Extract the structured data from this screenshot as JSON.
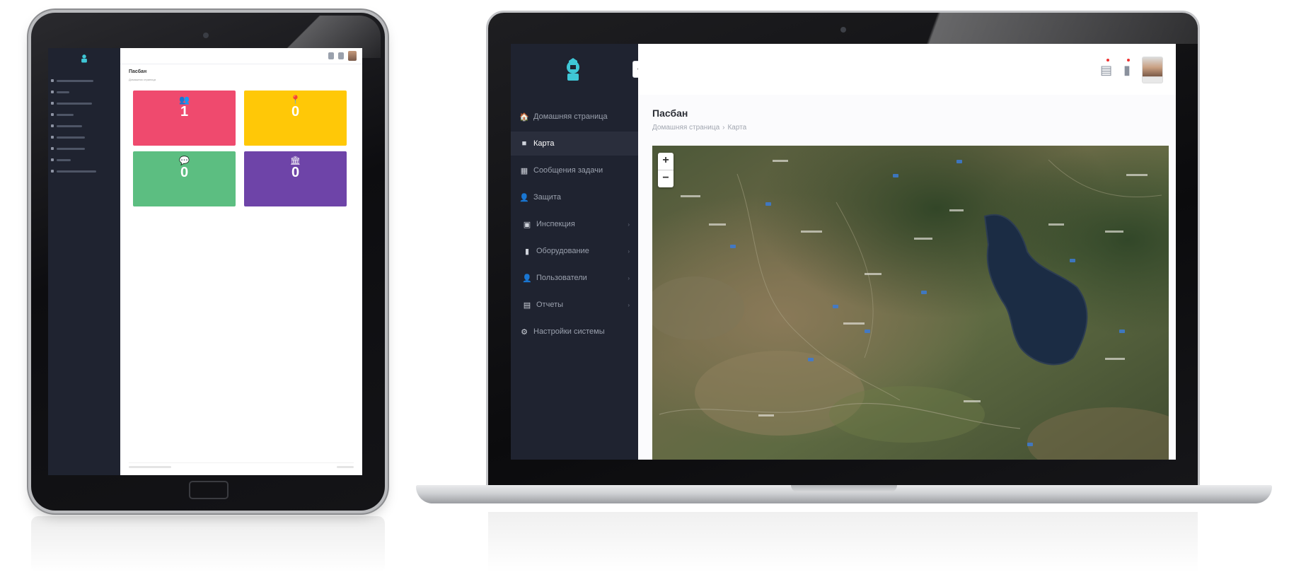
{
  "app": {
    "title": "Пасбан",
    "breadcrumb": [
      "Домашняя страница",
      "Карта"
    ],
    "breadcrumb_sep": "›"
  },
  "sidebar": {
    "items": [
      {
        "label": "Домашняя страница",
        "icon": "home-icon",
        "glyph": "🏠"
      },
      {
        "label": "Карта",
        "icon": "map-icon",
        "glyph": "■",
        "active": true
      },
      {
        "label": "Сообщения задачи",
        "icon": "messages-icon",
        "glyph": "▦"
      },
      {
        "label": "Защита",
        "icon": "user-icon",
        "glyph": "👤"
      },
      {
        "label": "Инспекция",
        "icon": "inspection-icon",
        "glyph": "▣",
        "has_children": true
      },
      {
        "label": "Оборудование",
        "icon": "equipment-icon",
        "glyph": "▮",
        "has_children": true
      },
      {
        "label": "Пользователи",
        "icon": "users-icon",
        "glyph": "👤",
        "has_children": true
      },
      {
        "label": "Отчеты",
        "icon": "reports-icon",
        "glyph": "▤",
        "has_children": true
      },
      {
        "label": "Настройки системы",
        "icon": "settings-icon",
        "glyph": "⚙"
      }
    ],
    "chevron": "›",
    "collapse_glyph": "‹"
  },
  "header": {
    "icons": [
      "server-icon",
      "notification-icon"
    ]
  },
  "map": {
    "zoom_in": "+",
    "zoom_out": "−"
  },
  "tablet": {
    "title": "Пасбан",
    "cards": [
      {
        "value": "1",
        "color": "#ef4a6e",
        "icon": "users-group-icon",
        "glyph": "👥"
      },
      {
        "value": "0",
        "color": "#ffc807",
        "icon": "pin-icon",
        "glyph": "📍"
      },
      {
        "value": "0",
        "color": "#5cbe81",
        "icon": "chat-icon",
        "glyph": "💬"
      },
      {
        "value": "0",
        "color": "#6e44a8",
        "icon": "building-icon",
        "glyph": "🏛"
      }
    ]
  },
  "colors": {
    "sidebar_bg": "#1f2330",
    "sidebar_active": "#2a2e3c",
    "lake": "#1b2c44"
  }
}
